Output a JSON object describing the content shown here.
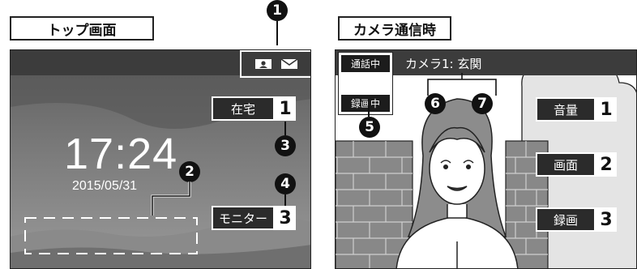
{
  "left_panel": {
    "title": "トップ画面",
    "clock": "17:24",
    "date": "2015/05/31",
    "buttons": [
      {
        "label": "在宅",
        "number": "1"
      },
      {
        "label": "モニター",
        "number": "3"
      }
    ],
    "markers": [
      "1",
      "2",
      "3",
      "4"
    ],
    "icons": [
      "contact-card-icon",
      "mail-icon"
    ]
  },
  "right_panel": {
    "title": "カメラ通信時",
    "camera_label": "カメラ1: 玄関",
    "status": [
      "通話中",
      "録画中"
    ],
    "buttons": [
      {
        "label": "音量",
        "number": "1"
      },
      {
        "label": "画面",
        "number": "2"
      },
      {
        "label": "録画",
        "number": "3"
      }
    ],
    "markers": [
      "5",
      "6",
      "7"
    ]
  },
  "colors": {
    "bar": "#3c3c3c",
    "button": "#2b2b2b",
    "marker": "#111111"
  }
}
